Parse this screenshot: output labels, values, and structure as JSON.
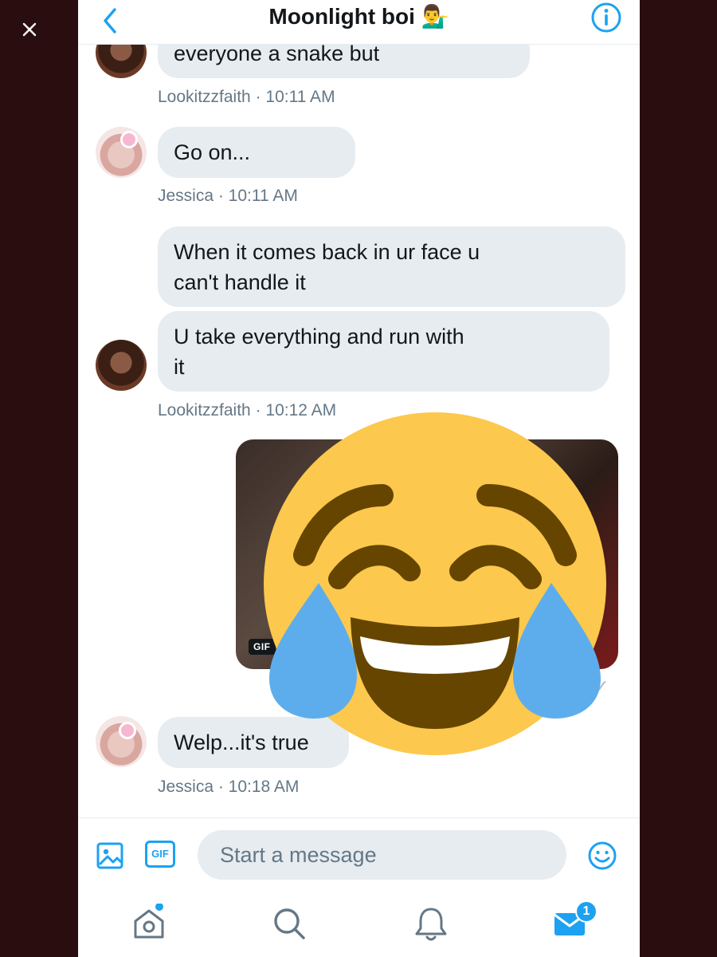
{
  "colors": {
    "accent": "#1da1f2",
    "bubble": "#e6ecf0",
    "meta_text": "#657786",
    "backdrop": "#2a0d0f",
    "emoji_face": "#fcc84d",
    "emoji_tear": "#5dadec",
    "emoji_mouth": "#664500"
  },
  "conversation": {
    "title": "Moonlight boi 💁‍♂️",
    "back_icon": "chevron-left-icon",
    "info_icon": "info-icon"
  },
  "messages": [
    {
      "sender": "Lookitzzfaith",
      "lines": [
        "everyone a snake but"
      ],
      "meta": "Lookitzzfaith · 10:11 AM"
    },
    {
      "sender": "Jessica",
      "lines": [
        "Go on..."
      ],
      "meta": "Jessica · 10:11 AM"
    },
    {
      "sender": "Lookitzzfaith",
      "lines": [
        "When it comes back in ur face u",
        "can't handle it"
      ]
    },
    {
      "sender": "Lookitzzfaith",
      "lines": [
        "U take everything and run with",
        "it"
      ],
      "meta": "Lookitzzfaith · 10:12 AM"
    },
    {
      "sender": "me",
      "attachment": "gif",
      "gif_label": "GIF"
    },
    {
      "sender": "Jessica",
      "lines": [
        "Welp...it's true"
      ],
      "meta": "Jessica · 10:18 AM"
    }
  ],
  "overlay": {
    "emoji": "face-with-tears-of-joy"
  },
  "composer": {
    "placeholder": "Start a message",
    "value": "",
    "gif_button_label": "GIF",
    "icons": [
      "image-icon",
      "gif-icon",
      "emoji-icon"
    ]
  },
  "tabbar": {
    "tabs": [
      "home",
      "search",
      "notifications",
      "messages"
    ],
    "messages_badge": "1"
  }
}
